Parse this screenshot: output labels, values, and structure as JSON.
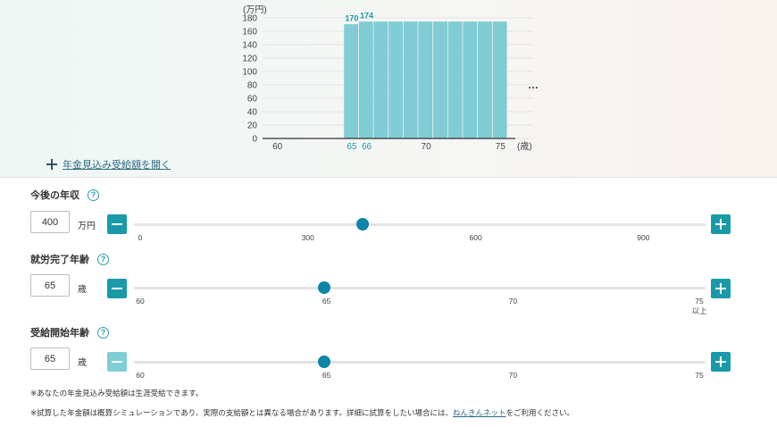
{
  "chart_data": {
    "type": "bar",
    "ylabel": "(万円)",
    "xunit": "(歳)",
    "y_ticks": [
      0,
      20,
      40,
      60,
      80,
      100,
      120,
      140,
      160,
      180
    ],
    "ylim": [
      0,
      180
    ],
    "x_ticks": [
      "60",
      "65",
      "66",
      "70",
      "75"
    ],
    "x_ticks_highlighted": [
      "65",
      "66"
    ],
    "x": [
      65,
      66,
      67,
      68,
      69,
      70,
      71,
      72,
      73,
      74,
      75
    ],
    "values": [
      170,
      174,
      174,
      174,
      174,
      174,
      174,
      174,
      174,
      174,
      174
    ],
    "bar_labels": [
      "170",
      "174"
    ],
    "more_indicator": "…",
    "bar_color": "#80cdd6",
    "highlight_color": "#1a9aa8"
  },
  "expander": {
    "label": "年金見込み受給額を開く"
  },
  "income": {
    "title": "今後の年収",
    "value": "400",
    "unit": "万円",
    "slider_fraction": 0.4,
    "ticks": [
      "0",
      "300",
      "600",
      "900"
    ]
  },
  "retire": {
    "title": "就労完了年齢",
    "value": "65",
    "unit": "歳",
    "slider_fraction": 0.333,
    "ticks": [
      "60",
      "65",
      "70",
      "75"
    ],
    "last_tick_sub": "以上"
  },
  "pension": {
    "title": "受給開始年齢",
    "value": "65",
    "unit": "歳",
    "slider_fraction": 0.333,
    "ticks": [
      "60",
      "65",
      "70",
      "75"
    ]
  },
  "help_icon": "?",
  "notes": {
    "line1": "※あなたの年金見込み受給額は生涯受給できます。",
    "line2_a": "※試算した年金額は概算シミュレーションであり、実際の支給額とは異なる場合があります。詳細に試算をしたい場合には、",
    "line2_link": "ねんきんネット",
    "line2_b": "をご利用ください。"
  },
  "colors": {
    "accent": "#1a9aa8",
    "thumb": "#0b86a9",
    "link": "#2b6c84"
  }
}
